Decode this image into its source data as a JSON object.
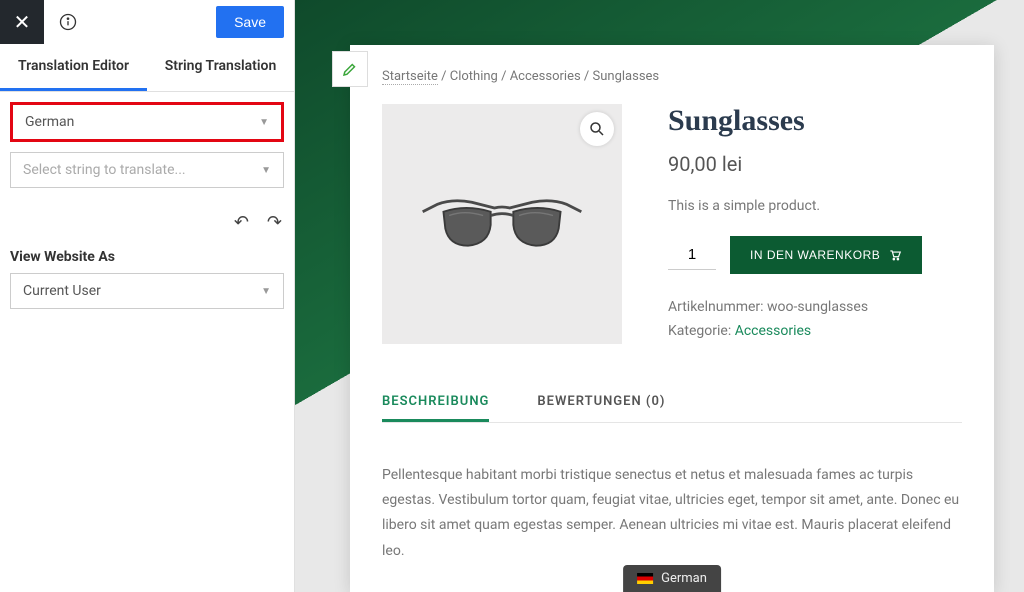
{
  "toolbar": {
    "save": "Save"
  },
  "tabs": {
    "editor": "Translation Editor",
    "string": "String Translation"
  },
  "lang_select": {
    "value": "German"
  },
  "string_select": {
    "placeholder": "Select string to translate..."
  },
  "view_as": {
    "label": "View Website As",
    "value": "Current User"
  },
  "breadcrumb": {
    "home": "Startseite",
    "sep1": " / ",
    "c1": "Clothing",
    "c2": "Accessories",
    "c3": "Sunglasses"
  },
  "product": {
    "title": "Sunglasses",
    "price": "90,00 lei",
    "short": "This is a simple product.",
    "qty": "1",
    "addcart": "IN DEN WARENKORB",
    "sku_label": "Artikelnummer: ",
    "sku": "woo-sunglasses",
    "cat_label": "Kategorie: ",
    "cat": "Accessories"
  },
  "ptabs": {
    "desc": "BESCHREIBUNG",
    "rev": "BEWERTUNGEN (0)"
  },
  "long": "Pellentesque habitant morbi tristique senectus et netus et malesuada fames ac turpis egestas. Vestibulum tortor quam, feugiat vitae, ultricies eget, tempor sit amet, ante. Donec eu libero sit amet quam egestas semper. Aenean ultricies mi vitae est. Mauris placerat eleifend leo.",
  "lang_pill": "German"
}
